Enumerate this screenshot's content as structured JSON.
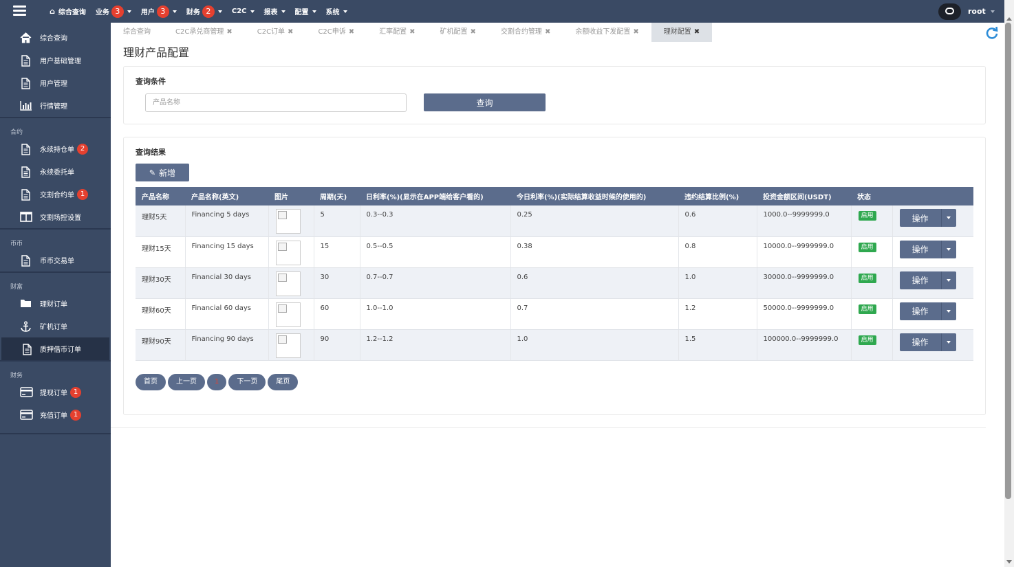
{
  "topnav": {
    "items": [
      {
        "label": "综合查询",
        "badge": null,
        "caret": false,
        "home": true
      },
      {
        "label": "业务",
        "badge": "3",
        "caret": true
      },
      {
        "label": "用户",
        "badge": "3",
        "caret": true
      },
      {
        "label": "财务",
        "badge": "2",
        "caret": true
      },
      {
        "label": "C2C",
        "badge": null,
        "caret": true
      },
      {
        "label": "报表",
        "badge": null,
        "caret": true
      },
      {
        "label": "配置",
        "badge": null,
        "caret": true
      },
      {
        "label": "系统",
        "badge": null,
        "caret": true
      }
    ],
    "user": "root"
  },
  "sidebar": {
    "sections": [
      {
        "head": "",
        "items": [
          {
            "label": "综合查询",
            "icon": "home-icon"
          },
          {
            "label": "用户基础管理",
            "icon": "document-icon"
          },
          {
            "label": "用户管理",
            "icon": "document-icon"
          },
          {
            "label": "行情管理",
            "icon": "bar-chart-icon"
          }
        ]
      },
      {
        "head": "合约",
        "items": [
          {
            "label": "永续持仓单",
            "icon": "document-icon",
            "badge": "2"
          },
          {
            "label": "永续委托单",
            "icon": "document-icon"
          },
          {
            "label": "交割合约单",
            "icon": "document-icon",
            "badge": "1"
          },
          {
            "label": "交割场控设置",
            "icon": "columns-icon"
          }
        ]
      },
      {
        "head": "币币",
        "items": [
          {
            "label": "币币交易单",
            "icon": "document-icon"
          }
        ]
      },
      {
        "head": "财富",
        "items": [
          {
            "label": "理财订单",
            "icon": "folder-icon"
          },
          {
            "label": "矿机订单",
            "icon": "anchor-icon"
          },
          {
            "label": "质押借币订单",
            "icon": "document-icon",
            "active": true
          }
        ]
      },
      {
        "head": "财务",
        "items": [
          {
            "label": "提现订单",
            "icon": "credit-card-icon",
            "badge": "1"
          },
          {
            "label": "充值订单",
            "icon": "credit-card-icon",
            "badge": "1"
          }
        ]
      }
    ]
  },
  "tabs": [
    {
      "label": "综合查询",
      "close": false
    },
    {
      "label": "C2C承兑商管理",
      "close": true
    },
    {
      "label": "C2C订单",
      "close": true
    },
    {
      "label": "C2C申诉",
      "close": true
    },
    {
      "label": "汇率配置",
      "close": true
    },
    {
      "label": "矿机配置",
      "close": true
    },
    {
      "label": "交割合约管理",
      "close": true
    },
    {
      "label": "余额收益下发配置",
      "close": true
    },
    {
      "label": "理财配置",
      "close": true,
      "active": true
    }
  ],
  "page": {
    "title": "理财产品配置",
    "query_title": "查询条件",
    "search_placeholder": "产品名称",
    "search_button": "查询",
    "result_title": "查询结果",
    "add_button": "新增"
  },
  "table": {
    "headers": [
      "产品名称",
      "产品名称(英文)",
      "图片",
      "周期(天)",
      "日利率(%)(显示在APP端给客户看的)",
      "今日利率(%)(实际结算收益时候的使用的)",
      "违约结算比例(%)",
      "投资金额区间(USDT)",
      "状态",
      ""
    ],
    "rows": [
      {
        "name": "理财5天",
        "name_en": "Financing 5 days",
        "period": "5",
        "daily_rate": "0.3--0.3",
        "today_rate": "0.25",
        "penalty": "0.6",
        "range": "1000.0--9999999.0",
        "status": "启用"
      },
      {
        "name": "理财15天",
        "name_en": "Financing 15 days",
        "period": "15",
        "daily_rate": "0.5--0.5",
        "today_rate": "0.38",
        "penalty": "0.8",
        "range": "10000.0--9999999.0",
        "status": "启用"
      },
      {
        "name": "理财30天",
        "name_en": "Financial 30 days",
        "period": "30",
        "daily_rate": "0.7--0.7",
        "today_rate": "0.6",
        "penalty": "1.0",
        "range": "30000.0--9999999.0",
        "status": "启用"
      },
      {
        "name": "理财60天",
        "name_en": "Financial 60 days",
        "period": "60",
        "daily_rate": "1.0--1.0",
        "today_rate": "0.7",
        "penalty": "1.2",
        "range": "50000.0--9999999.0",
        "status": "启用"
      },
      {
        "name": "理财90天",
        "name_en": "Financing 90 days",
        "period": "90",
        "daily_rate": "1.2--1.2",
        "today_rate": "1.0",
        "penalty": "1.5",
        "range": "100000.0--9999999.0",
        "status": "启用"
      }
    ],
    "op_label": "操作"
  },
  "pager": {
    "first": "首页",
    "prev": "上一页",
    "current": "1",
    "next": "下一页",
    "last": "尾页"
  },
  "colors": {
    "nav_bg": "#3a4a64",
    "button": "#5b6c8c",
    "badge": "#e5402f",
    "status_green": "#2fa84f"
  }
}
